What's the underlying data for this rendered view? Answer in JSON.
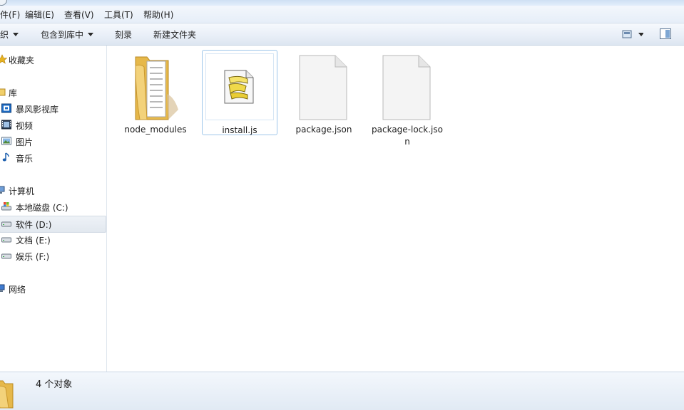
{
  "menu": [
    {
      "label": "件(F)"
    },
    {
      "label": "编辑(E)"
    },
    {
      "label": "查看(V)"
    },
    {
      "label": "工具(T)"
    },
    {
      "label": "帮助(H)"
    }
  ],
  "toolbar": {
    "organize": "织",
    "include_in_library": "包含到库中",
    "burn": "刻录",
    "new_folder": "新建文件夹"
  },
  "nav": {
    "favorites": "收藏夹",
    "libraries": "库",
    "lib_items": [
      "暴风影视库",
      "视频",
      "图片",
      "音乐"
    ],
    "computer": "计算机",
    "drives": [
      "本地磁盘 (C:)",
      "软件 (D:)",
      "文档 (E:)",
      "娱乐 (F:)"
    ],
    "network": "网络",
    "selected_drive": "软件 (D:)"
  },
  "files": [
    {
      "name": "node_modules",
      "type": "folder"
    },
    {
      "name": "install.js",
      "type": "script",
      "selected": true
    },
    {
      "name": "package.json",
      "type": "file"
    },
    {
      "name": "package-lock.json",
      "type": "file"
    }
  ],
  "status": {
    "count_text": "4 个对象"
  },
  "colors": {
    "selection_border": "#9ec6ea",
    "chrome_light": "#f3f7fc",
    "chrome_dark": "#dde6f1"
  }
}
